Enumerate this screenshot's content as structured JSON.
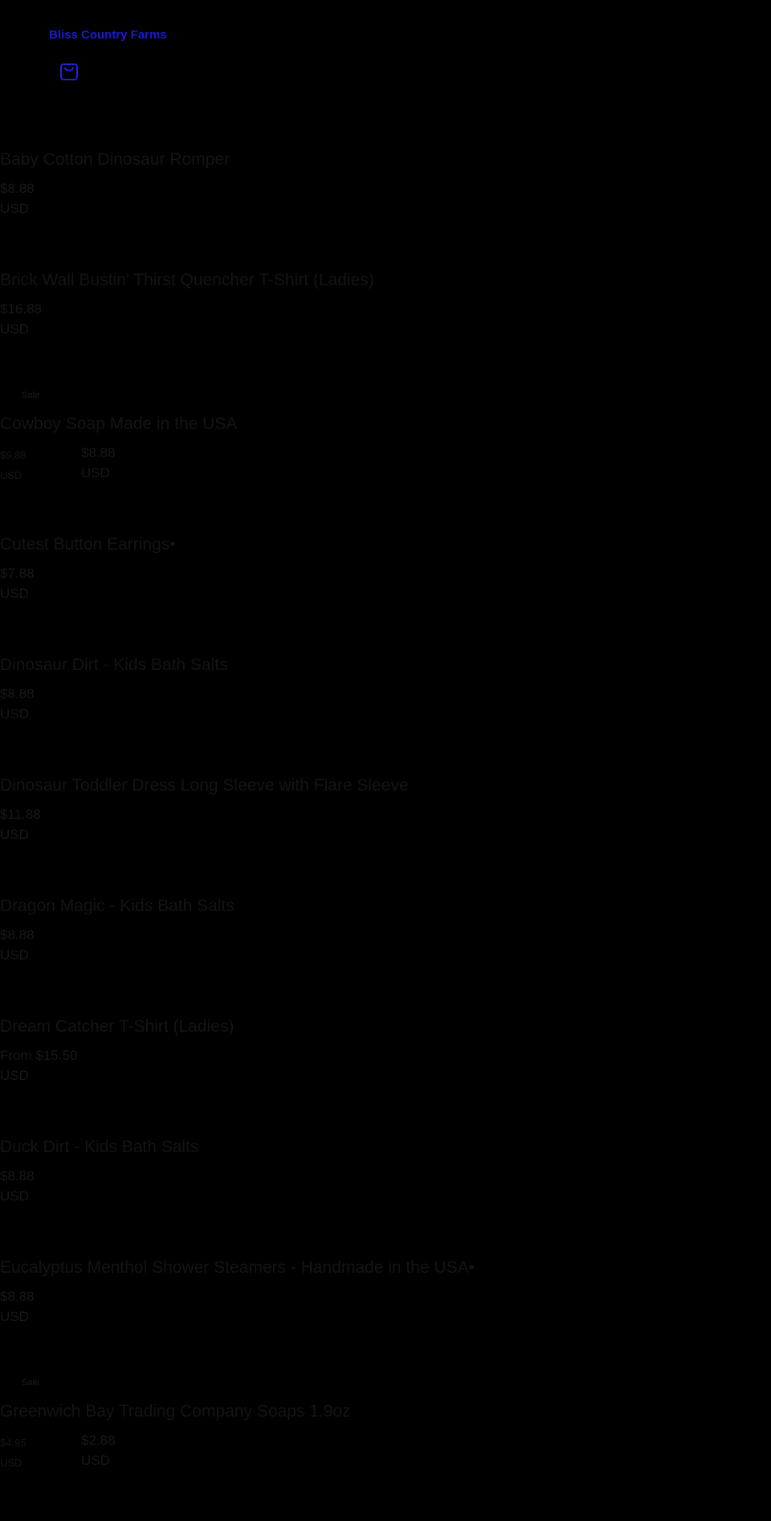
{
  "store": {
    "name": "Bliss Country Farms",
    "cart_icon": "shopping-bag-icon"
  },
  "products": [
    {
      "title": "Baby Cotton Dinosaur Romper",
      "price": "$8.88",
      "currency": "USD"
    },
    {
      "title": "Brick Wall Bustin' Thirst Quencher T-Shirt (Ladies)",
      "price": "$16.88",
      "currency": "USD"
    },
    {
      "badge": "Sale",
      "title": "Cowboy Soap Made in the USA",
      "compare_price": "$9.88",
      "compare_currency": "USD",
      "price": "$8.88",
      "currency": "USD"
    },
    {
      "title": "Cutest Button Earrings•",
      "price": "$7.88",
      "currency": "USD"
    },
    {
      "title": "Dinosaur Dirt - Kids Bath Salts",
      "price": "$8.88",
      "currency": "USD"
    },
    {
      "title": "Dinosaur Toddler Dress Long Sleeve with Flare Sleeve",
      "price": "$11.88",
      "currency": "USD"
    },
    {
      "title": "Dragon Magic - Kids Bath Salts",
      "price": "$8.88",
      "currency": "USD"
    },
    {
      "title": "Dream Catcher T-Shirt (Ladies)",
      "price": "From $15.50",
      "currency": "USD"
    },
    {
      "title": "Duck Dirt - Kids Bath Salts",
      "price": "$8.88",
      "currency": "USD"
    },
    {
      "title": "Eucalyptus Menthol Shower Steamers - Handmade in the USA•",
      "price": "$8.88",
      "currency": "USD"
    },
    {
      "badge": "Sale",
      "title": "Greenwich Bay Trading Company Soaps 1.9oz",
      "compare_price": "$4.95",
      "compare_currency": "USD",
      "price": "$2.88",
      "currency": "USD"
    }
  ]
}
